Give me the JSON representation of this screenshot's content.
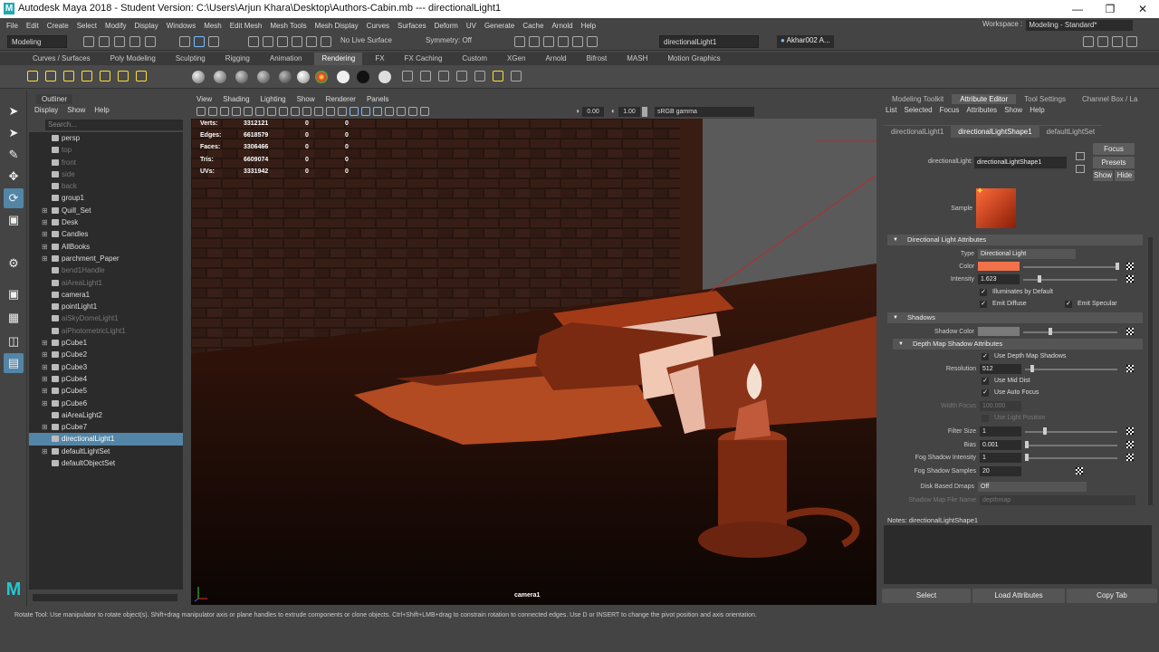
{
  "window": {
    "title": "Autodesk Maya 2018 - Student Version: C:\\Users\\Arjun Khara\\Desktop\\Authors-Cabin.mb   ---   directionalLight1"
  },
  "menubar": [
    "File",
    "Edit",
    "Create",
    "Select",
    "Modify",
    "Display",
    "Windows",
    "Mesh",
    "Edit Mesh",
    "Mesh Tools",
    "Mesh Display",
    "Curves",
    "Surfaces",
    "Deform",
    "UV",
    "Generate",
    "Cache",
    "Arnold",
    "Help"
  ],
  "workspace": {
    "label": "Workspace :",
    "value": "Modeling - Standard*"
  },
  "status": {
    "menuset": "Modeling",
    "live_surface": "No Live Surface",
    "symmetry": "Symmetry: Off",
    "object_field": "directionalLight1",
    "user": "Akhar002 A..."
  },
  "shelf_tabs": [
    "Curves / Surfaces",
    "Poly Modeling",
    "Sculpting",
    "Rigging",
    "Animation",
    "Rendering",
    "FX",
    "FX Caching",
    "Custom",
    "XGen",
    "Arnold",
    "Bifrost",
    "MASH",
    "Motion Graphics"
  ],
  "outliner": {
    "title": "Outliner",
    "menu": [
      "Display",
      "Show",
      "Help"
    ],
    "search_placeholder": "Search...",
    "items": [
      {
        "name": "persp",
        "dim": false,
        "ex": ""
      },
      {
        "name": "top",
        "dim": true,
        "ex": ""
      },
      {
        "name": "front",
        "dim": true,
        "ex": ""
      },
      {
        "name": "side",
        "dim": true,
        "ex": ""
      },
      {
        "name": "back",
        "dim": true,
        "ex": ""
      },
      {
        "name": "group1",
        "dim": false,
        "ex": ""
      },
      {
        "name": "Quill_Set",
        "dim": false,
        "ex": "+"
      },
      {
        "name": "Desk",
        "dim": false,
        "ex": "+"
      },
      {
        "name": "Candles",
        "dim": false,
        "ex": "+"
      },
      {
        "name": "AllBooks",
        "dim": false,
        "ex": "+"
      },
      {
        "name": "parchment_Paper",
        "dim": false,
        "ex": "+"
      },
      {
        "name": "bend1Handle",
        "dim": true,
        "ex": ""
      },
      {
        "name": "aiAreaLight1",
        "dim": true,
        "ex": ""
      },
      {
        "name": "camera1",
        "dim": false,
        "ex": ""
      },
      {
        "name": "pointLight1",
        "dim": false,
        "ex": ""
      },
      {
        "name": "aiSkyDomeLight1",
        "dim": true,
        "ex": ""
      },
      {
        "name": "aiPhotometricLight1",
        "dim": true,
        "ex": ""
      },
      {
        "name": "pCube1",
        "dim": false,
        "ex": "+"
      },
      {
        "name": "pCube2",
        "dim": false,
        "ex": "+"
      },
      {
        "name": "pCube3",
        "dim": false,
        "ex": "+"
      },
      {
        "name": "pCube4",
        "dim": false,
        "ex": "+"
      },
      {
        "name": "pCube5",
        "dim": false,
        "ex": "+"
      },
      {
        "name": "pCube6",
        "dim": false,
        "ex": "+"
      },
      {
        "name": "aiAreaLight2",
        "dim": false,
        "ex": ""
      },
      {
        "name": "pCube7",
        "dim": false,
        "ex": "+"
      },
      {
        "name": "directionalLight1",
        "dim": false,
        "ex": "",
        "selected": true
      },
      {
        "name": "defaultLightSet",
        "dim": false,
        "ex": "+"
      },
      {
        "name": "defaultObjectSet",
        "dim": false,
        "ex": ""
      }
    ]
  },
  "viewport": {
    "menu": [
      "View",
      "Shading",
      "Lighting",
      "Show",
      "Renderer",
      "Panels"
    ],
    "exposure": "0.00",
    "gamma": "1.00",
    "color_space": "sRGB gamma",
    "camera": "camera1",
    "hud": [
      {
        "label": "Verts:",
        "v": "3312121",
        "a": "0",
        "b": "0"
      },
      {
        "label": "Edges:",
        "v": "6618579",
        "a": "0",
        "b": "0"
      },
      {
        "label": "Faces:",
        "v": "3306466",
        "a": "0",
        "b": "0"
      },
      {
        "label": "Tris:",
        "v": "6609074",
        "a": "0",
        "b": "0"
      },
      {
        "label": "UVs:",
        "v": "3331942",
        "a": "0",
        "b": "0"
      }
    ]
  },
  "attr": {
    "panel_tabs": [
      "Modeling Toolkit",
      "Attribute Editor",
      "Tool Settings",
      "Channel Box / La"
    ],
    "menu": [
      "List",
      "Selected",
      "Focus",
      "Attributes",
      "Show",
      "Help"
    ],
    "node_tabs": [
      "directionalLight1",
      "directionalLightShape1",
      "defaultLightSet"
    ],
    "node_label": "directionalLight:",
    "node_value": "directionalLightShape1",
    "focus": "Focus",
    "presets": "Presets",
    "show": "Show",
    "hide": "Hide",
    "sample": "Sample",
    "sec_light": "Directional Light Attributes",
    "type_label": "Type",
    "type_value": "Directional Light",
    "color_label": "Color",
    "intensity_label": "Intensity",
    "intensity": "1.623",
    "illum": "Illuminates by Default",
    "diffuse": "Emit Diffuse",
    "specular": "Emit Specular",
    "sec_shadows": "Shadows",
    "shadow_color": "Shadow Color",
    "sec_depth": "Depth Map Shadow Attributes",
    "use_dms": "Use Depth Map Shadows",
    "res_label": "Resolution",
    "res": "512",
    "mid": "Use Mid Dist",
    "auto": "Use Auto Focus",
    "wf_label": "Width Focus",
    "wf": "100.000",
    "ulp": "Use Light Position",
    "fs_label": "Filter Size",
    "fs": "1",
    "bias_label": "Bias",
    "bias": "0.001",
    "fsi_label": "Fog Shadow Intensity",
    "fsi": "1",
    "fss_label": "Fog Shadow Samples",
    "fss": "20",
    "dbd_label": "Disk Based Dmaps",
    "dbd": "Off",
    "smf_label": "Shadow Map File Name",
    "smf": "depthmap",
    "notes": "Notes:  directionalLightShape1",
    "bottom": [
      "Select",
      "Load Attributes",
      "Copy Tab"
    ]
  },
  "colors": {
    "light": "#f0714a",
    "accent": "#5285a6"
  },
  "statusbar": "Rotate Tool: Use manipulator to rotate object(s). Shift+drag manipulator axis or plane handles to extrude components or clone objects. Ctrl+Shift+LMB+drag to constrain rotation to connected edges. Use D or INSERT to change the pivot position and axis orientation."
}
